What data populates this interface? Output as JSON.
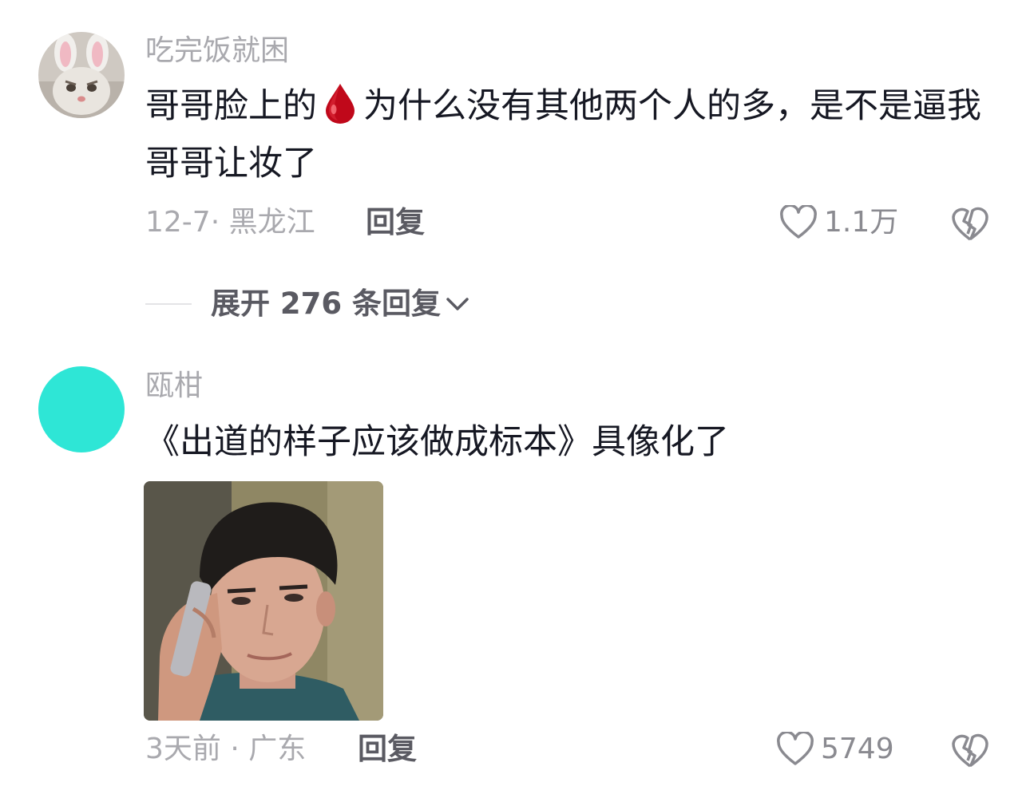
{
  "comments": [
    {
      "username": "吃完饭就困",
      "text_part1": "哥哥脸上的",
      "emoji": "blood-drop-icon",
      "text_part2": "为什么没有其他两个人的多，是不是逼我哥哥让妆了",
      "time_location": "12-7· 黑龙江",
      "reply_label": "回复",
      "like_count": "1.1万",
      "avatar": "bunny-cat-avatar"
    },
    {
      "username": "瓯柑",
      "text": "《出道的样子应该做成标本》具像化了",
      "image": "man-on-phone-photo",
      "time_location": "3天前 · 广东",
      "reply_label": "回复",
      "like_count": "5749",
      "avatar_color": "#2ee6d6"
    }
  ],
  "expand_replies": {
    "label": "展开 276 条回复"
  },
  "colors": {
    "text": "#161823",
    "secondary": "#a9a9ae",
    "accent_teal": "#2ee6d6"
  }
}
